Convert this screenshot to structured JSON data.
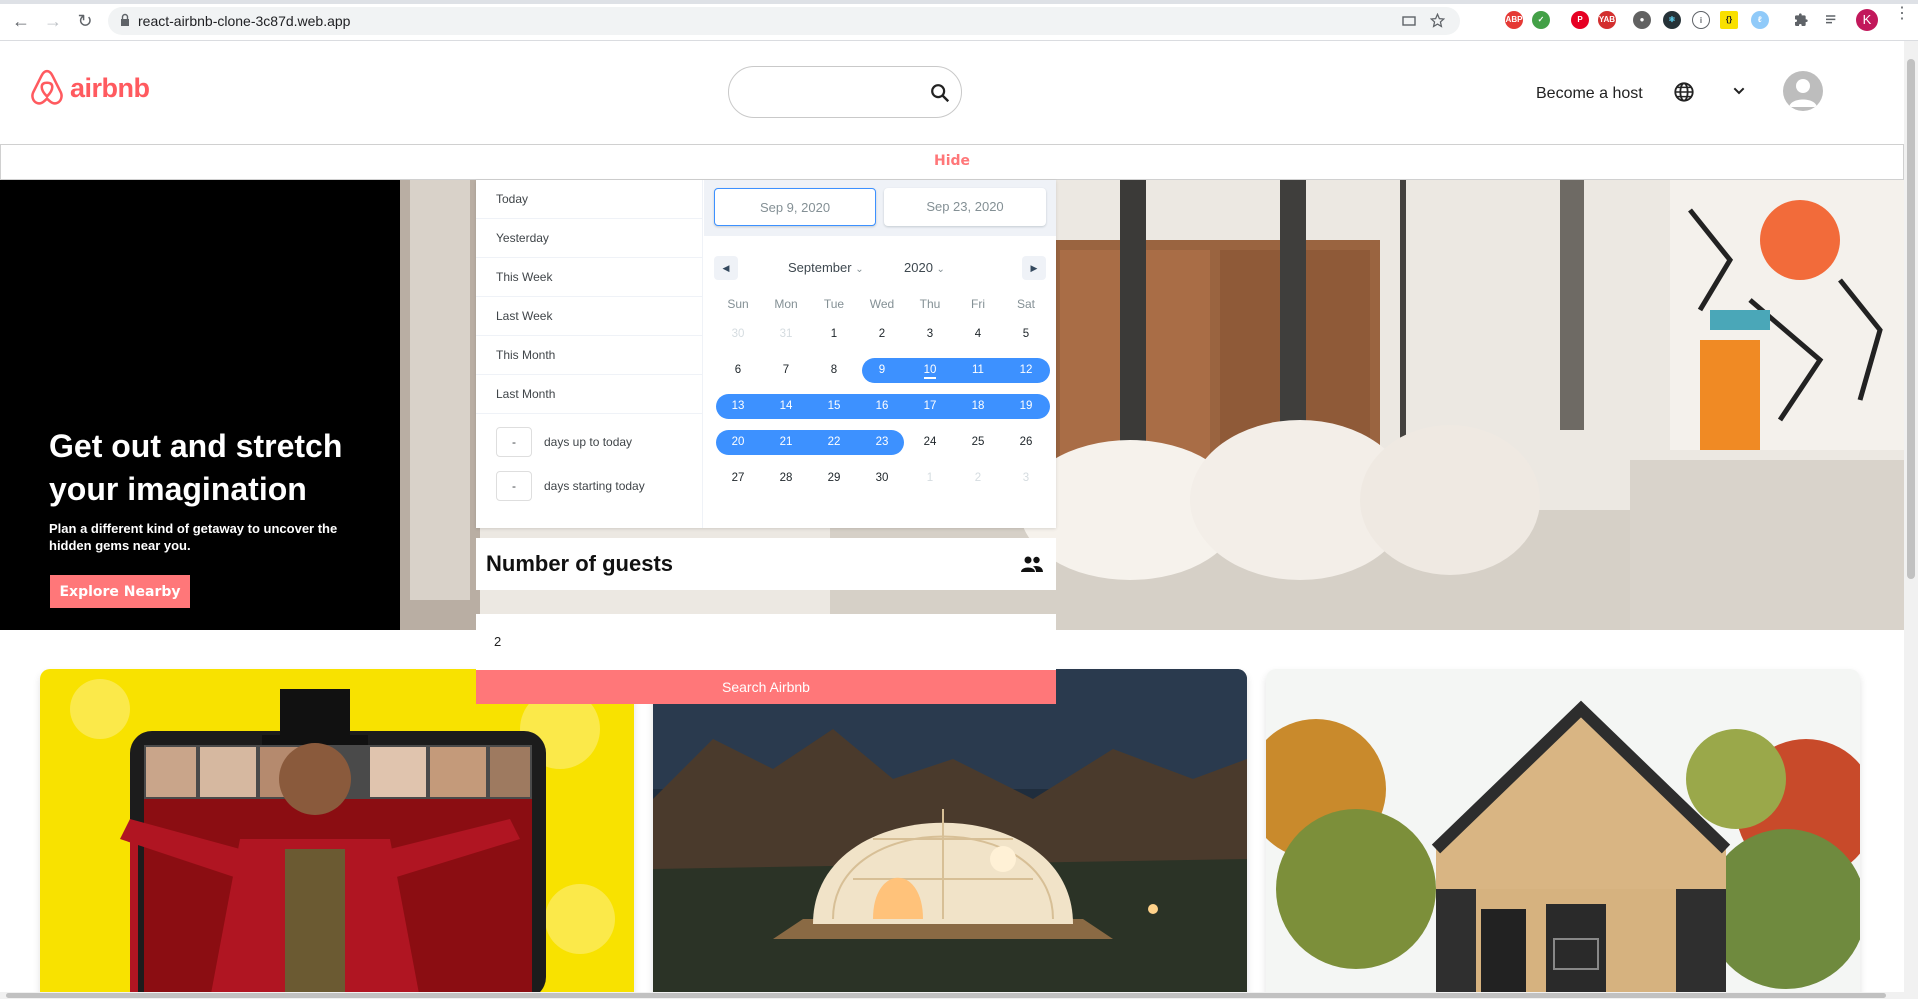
{
  "browser": {
    "url": "react-airbnb-clone-3c87d.web.app",
    "profile_initial": "K"
  },
  "header": {
    "logo_text": "airbnb",
    "search_placeholder": "",
    "become_host": "Become a host"
  },
  "hide_button": "Hide",
  "hero": {
    "title": "Get out and stretch your imagination",
    "subtitle": "Plan a different kind of getaway to uncover the hidden gems near you.",
    "button": "Explore Nearby"
  },
  "date_picker": {
    "static_ranges": [
      "Today",
      "Yesterday",
      "This Week",
      "Last Week",
      "This Month",
      "Last Month"
    ],
    "input_ranges": [
      {
        "value": "-",
        "label": "days up to today"
      },
      {
        "value": "-",
        "label": "days starting today"
      }
    ],
    "start_date": "Sep 9, 2020",
    "end_date": "Sep 23, 2020",
    "month": "September",
    "year": "2020",
    "weekdays": [
      "Sun",
      "Mon",
      "Tue",
      "Wed",
      "Thu",
      "Fri",
      "Sat"
    ],
    "weeks": [
      [
        "30",
        "31",
        "1",
        "2",
        "3",
        "4",
        "5"
      ],
      [
        "6",
        "7",
        "8",
        "9",
        "10",
        "11",
        "12"
      ],
      [
        "13",
        "14",
        "15",
        "16",
        "17",
        "18",
        "19"
      ],
      [
        "20",
        "21",
        "22",
        "23",
        "24",
        "25",
        "26"
      ],
      [
        "27",
        "28",
        "29",
        "30",
        "1",
        "2",
        "3"
      ]
    ],
    "accent_color": "#3d91ff"
  },
  "guests": {
    "title": "Number of guests",
    "value": "2",
    "search_button": "Search Airbnb"
  },
  "colors": {
    "brand": "#ff5a5f",
    "button": "#ff7779"
  }
}
